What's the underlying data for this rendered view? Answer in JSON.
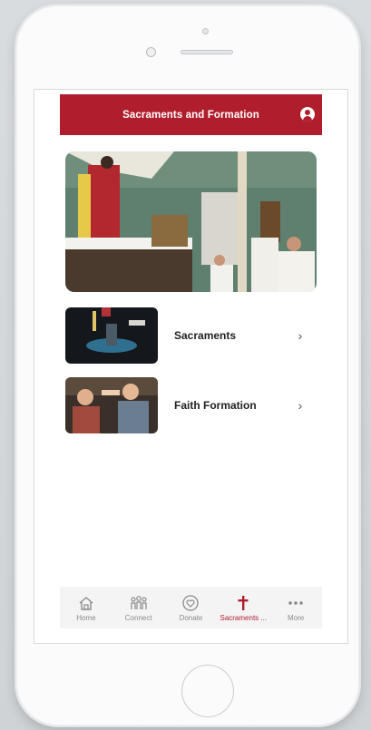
{
  "header": {
    "title": "Sacraments and Formation",
    "profile_icon": "user-circle-icon"
  },
  "colors": {
    "brand_red": "#b01e2d",
    "tab_inactive": "#8a8a8a"
  },
  "list": [
    {
      "label": "Sacraments",
      "chevron": "›"
    },
    {
      "label": "Faith Formation",
      "chevron": "›"
    }
  ],
  "tabs": [
    {
      "label": "Home",
      "icon": "home-icon",
      "active": false
    },
    {
      "label": "Connect",
      "icon": "people-icon",
      "active": false
    },
    {
      "label": "Donate",
      "icon": "heart-icon",
      "active": false
    },
    {
      "label": "Sacraments ...",
      "icon": "cross-icon",
      "active": true
    },
    {
      "label": "More",
      "icon": "more-dots-icon",
      "active": false
    }
  ]
}
